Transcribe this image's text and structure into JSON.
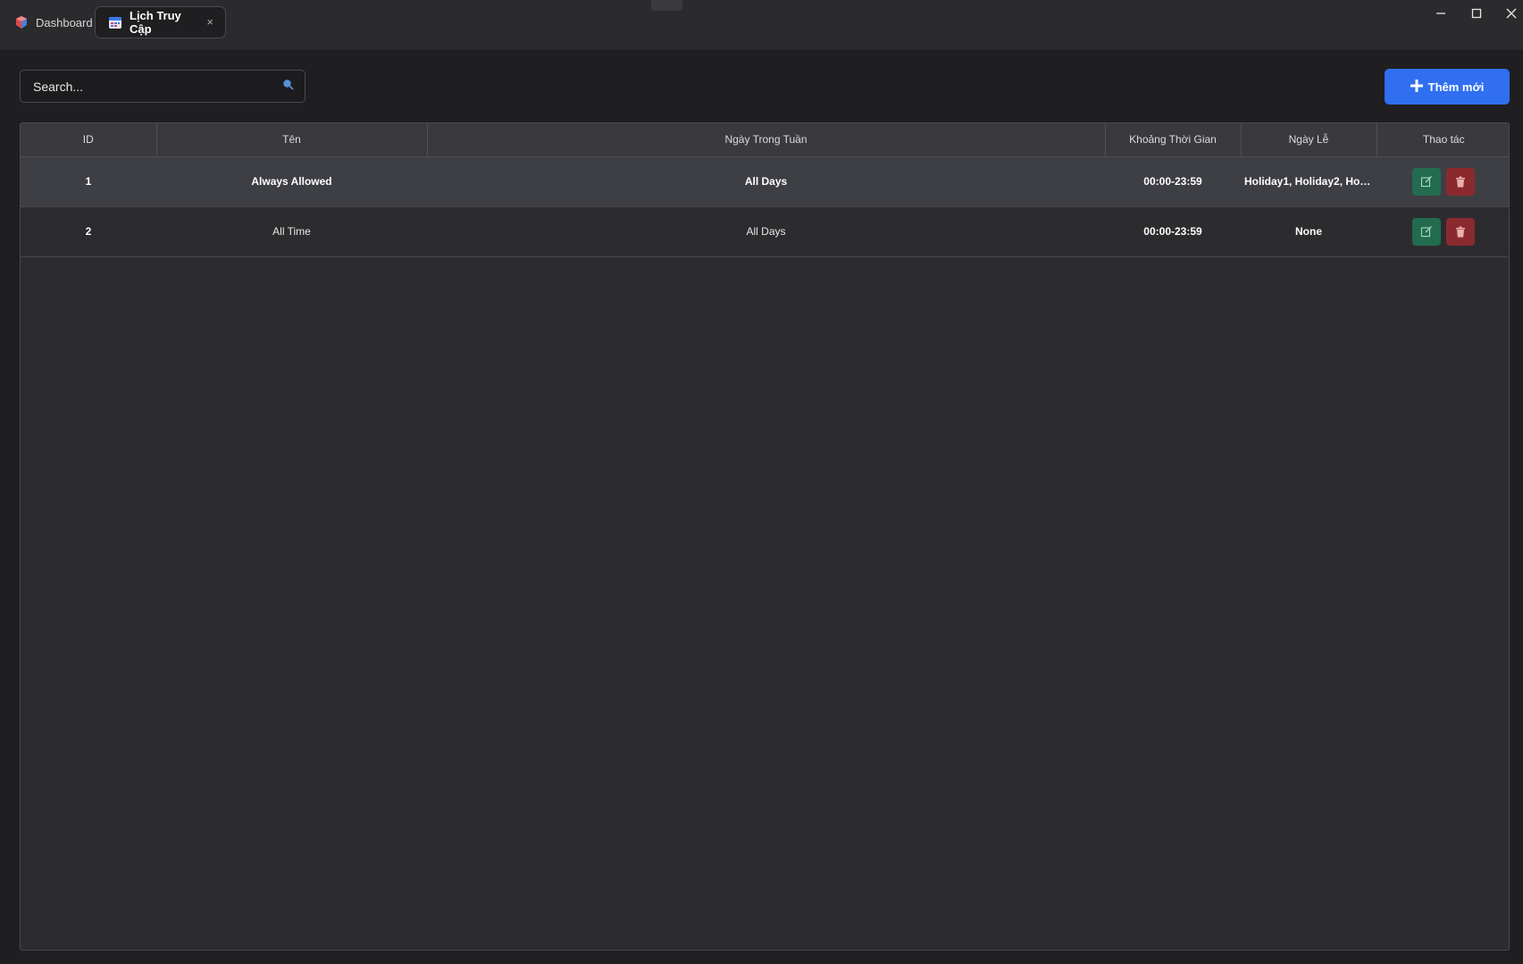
{
  "tabs": {
    "dashboard": {
      "label": "Dashboard",
      "icon": "app-logo-icon"
    },
    "active": {
      "label": "Lịch Truy Cập",
      "icon": "calendar-icon",
      "close": "×"
    }
  },
  "search": {
    "placeholder": "Search...",
    "icon": "search-icon"
  },
  "add_button": {
    "label": "Thêm mới",
    "icon": "plus-icon",
    "color": "#2f6ff0"
  },
  "table": {
    "columns": [
      "ID",
      "Tên",
      "Ngày Trong Tuần",
      "Khoảng Thời Gian",
      "Ngày Lễ",
      "Thao tác"
    ],
    "rows": [
      {
        "id": "1",
        "name": "Always Allowed",
        "weekdays": "All Days",
        "time_range": "00:00-23:59",
        "holidays": "Holiday1, Holiday2, Holid..."
      },
      {
        "id": "2",
        "name": "All Time",
        "weekdays": "All Days",
        "time_range": "00:00-23:59",
        "holidays": "None"
      }
    ],
    "edit_icon": "edit-icon",
    "delete_icon": "trash-icon",
    "edit_color": "#236b4f",
    "delete_color": "#8b2a2e"
  }
}
